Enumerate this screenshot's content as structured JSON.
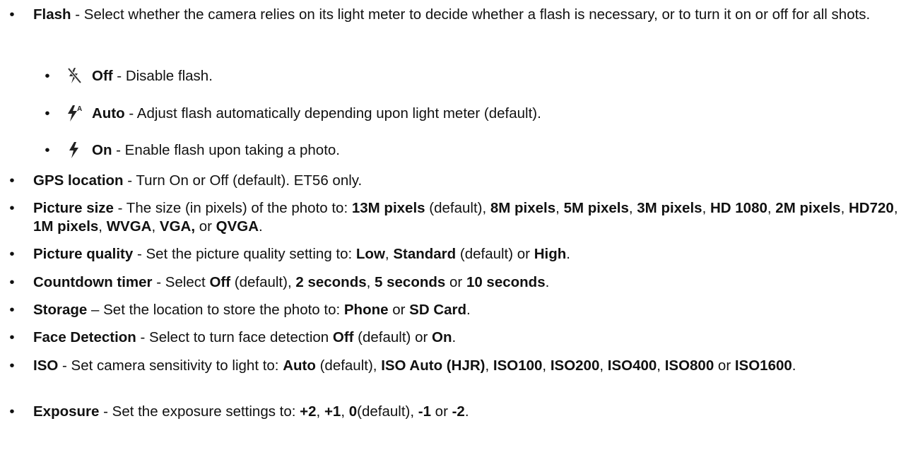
{
  "bullet_char": "•",
  "items": [
    {
      "parts": [
        {
          "b": "Flash"
        },
        {
          "t": " - Select whether the camera relies on its light meter to decide whether a flash is necessary, or to turn it on or off for all shots."
        }
      ]
    },
    {
      "sub": true,
      "icon": "flash-off-icon",
      "parts": [
        {
          "b": "Off"
        },
        {
          "t": " - Disable flash."
        }
      ]
    },
    {
      "sub": true,
      "icon": "flash-auto-icon",
      "parts": [
        {
          "b": "Auto"
        },
        {
          "t": " - Adjust flash automatically depending upon light meter (default)."
        }
      ]
    },
    {
      "sub": true,
      "icon": "flash-on-icon",
      "parts": [
        {
          "b": "On"
        },
        {
          "t": " - Enable flash upon taking a photo."
        }
      ]
    },
    {
      "parts": [
        {
          "b": "GPS location"
        },
        {
          "t": " - Turn On or Off (default). ET56 only."
        }
      ]
    },
    {
      "parts": [
        {
          "b": "Picture size"
        },
        {
          "t": " - The size (in pixels) of the photo to: "
        },
        {
          "b": "13M pixels"
        },
        {
          "t": " (default), "
        },
        {
          "b": "8M pixels"
        },
        {
          "t": ", "
        },
        {
          "b": "5M pixels"
        },
        {
          "t": ", "
        },
        {
          "b": "3M pixels"
        },
        {
          "t": ", "
        },
        {
          "b": "HD 1080"
        },
        {
          "t": ", "
        },
        {
          "b": "2M pixels"
        },
        {
          "t": ", "
        },
        {
          "b": "HD720"
        },
        {
          "t": ", "
        },
        {
          "b": "1M pixels"
        },
        {
          "t": ", "
        },
        {
          "b": "WVGA"
        },
        {
          "t": ", "
        },
        {
          "b": "VGA,"
        },
        {
          "t": " or "
        },
        {
          "b": "QVGA"
        },
        {
          "t": "."
        }
      ]
    },
    {
      "parts": [
        {
          "b": "Picture quality"
        },
        {
          "t": " - Set the picture quality setting to: "
        },
        {
          "b": "Low"
        },
        {
          "t": ", "
        },
        {
          "b": "Standard"
        },
        {
          "t": " (default) or "
        },
        {
          "b": "High"
        },
        {
          "t": "."
        }
      ]
    },
    {
      "parts": [
        {
          "b": "Countdown timer"
        },
        {
          "t": " - Select "
        },
        {
          "b": "Off"
        },
        {
          "t": " (default), "
        },
        {
          "b": "2 seconds"
        },
        {
          "t": ", "
        },
        {
          "b": "5 seconds"
        },
        {
          "t": " or "
        },
        {
          "b": "10 seconds"
        },
        {
          "t": "."
        }
      ]
    },
    {
      "parts": [
        {
          "b": "Storage"
        },
        {
          "t": " – Set the location to store the photo to: "
        },
        {
          "b": "Phone"
        },
        {
          "t": " or "
        },
        {
          "b": "SD Card"
        },
        {
          "t": "."
        }
      ]
    },
    {
      "parts": [
        {
          "b": "Face Detection"
        },
        {
          "t": " - Select to turn face detection "
        },
        {
          "b": "Off"
        },
        {
          "t": " (default) or "
        },
        {
          "b": "On"
        },
        {
          "t": "."
        }
      ]
    },
    {
      "parts": [
        {
          "b": "ISO"
        },
        {
          "t": " - Set camera sensitivity to light to: "
        },
        {
          "b": "Auto"
        },
        {
          "t": " (default), "
        },
        {
          "b": "ISO Auto (HJR)"
        },
        {
          "t": ", "
        },
        {
          "b": "ISO100"
        },
        {
          "t": ", "
        },
        {
          "b": "ISO200"
        },
        {
          "t": ", "
        },
        {
          "b": "ISO400"
        },
        {
          "t": ", "
        },
        {
          "b": "ISO800"
        },
        {
          "t": " or "
        },
        {
          "b": "ISO1600"
        },
        {
          "t": "."
        }
      ]
    },
    {
      "parts": [
        {
          "b": "Exposure"
        },
        {
          "t": " - Set the exposure settings to: "
        },
        {
          "b": "+2"
        },
        {
          "t": ", "
        },
        {
          "b": "+1"
        },
        {
          "t": ", "
        },
        {
          "b": "0"
        },
        {
          "t": "(default), "
        },
        {
          "b": "-1"
        },
        {
          "t": " or "
        },
        {
          "b": "-2"
        },
        {
          "t": "."
        }
      ]
    }
  ],
  "icon_auto_letter": "A"
}
